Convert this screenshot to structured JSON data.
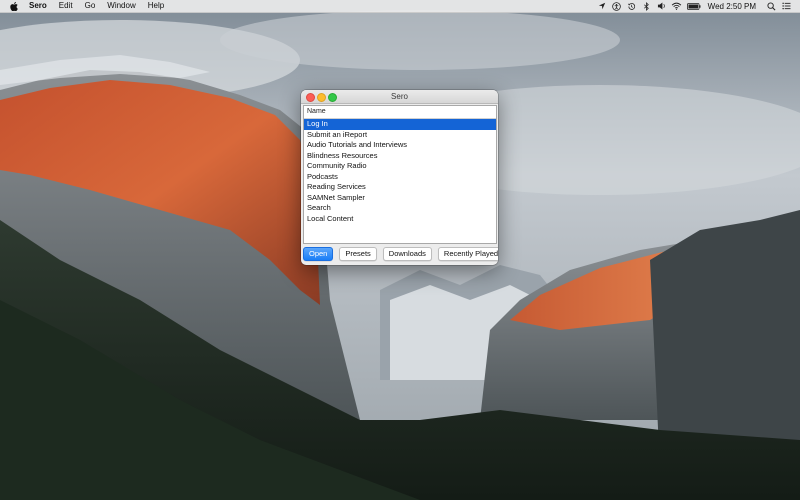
{
  "menubar": {
    "app_name": "Sero",
    "menus": [
      "Edit",
      "Go",
      "Window",
      "Help"
    ],
    "clock": "Wed 2:50 PM"
  },
  "window": {
    "title": "Sero",
    "list": {
      "header": "Name",
      "selected_index": 0,
      "items": [
        "Log In",
        "Submit an iReport",
        "Audio Tutorials and Interviews",
        "Blindness Resources",
        "Community Radio",
        "Podcasts",
        "Reading Services",
        "SAMNet Sampler",
        "Search",
        "Local Content"
      ]
    },
    "buttons": {
      "open": "Open",
      "presets": "Presets",
      "downloads": "Downloads",
      "recently_played": "Recently Played"
    }
  },
  "colors": {
    "selection": "#1464d6",
    "default_button": "#1a7ef7",
    "close": "#fc5e57",
    "minimize": "#fdbc2e",
    "zoom": "#33c748"
  },
  "icons": {
    "status": [
      "location-icon",
      "accessibility-icon",
      "time-machine-icon",
      "bluetooth-icon",
      "volume-icon",
      "wifi-icon",
      "battery-icon"
    ],
    "right": [
      "spotlight-search-icon",
      "notification-center-icon"
    ]
  }
}
